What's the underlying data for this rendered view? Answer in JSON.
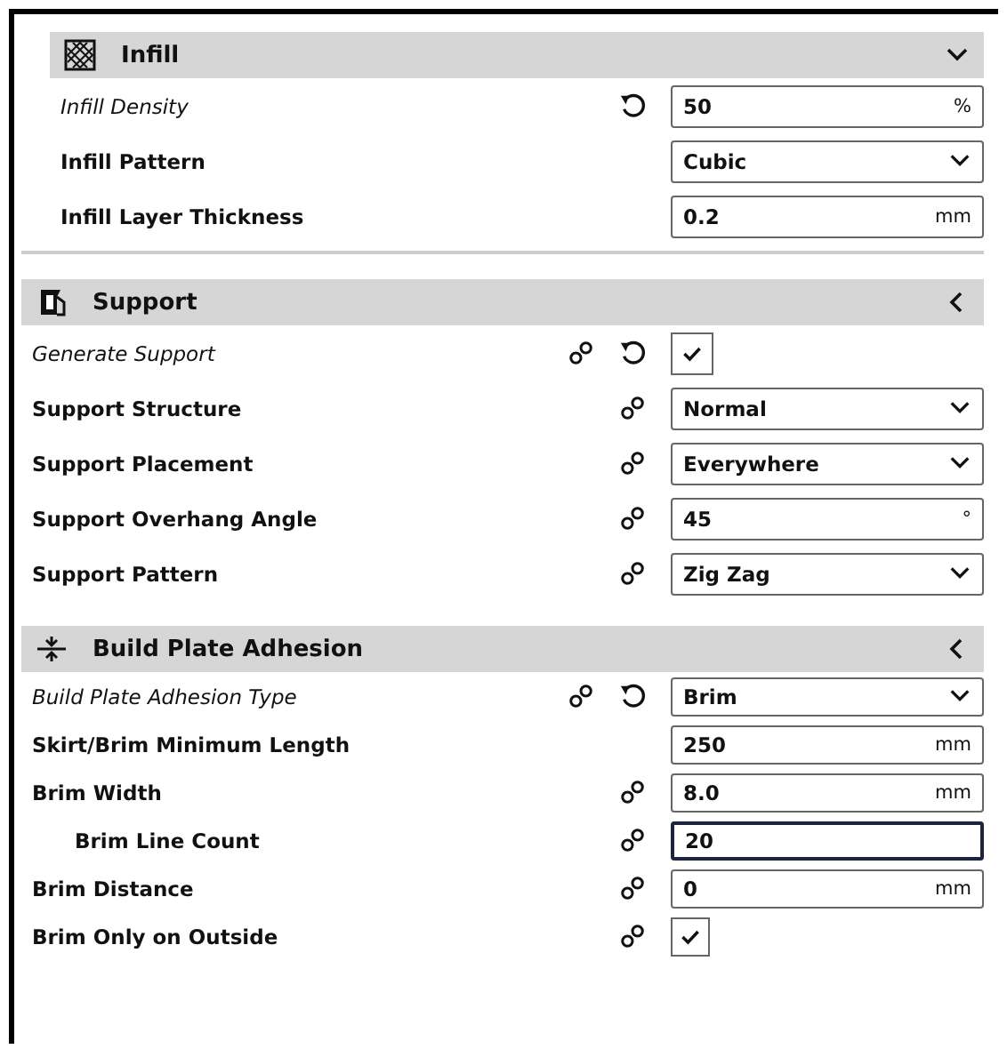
{
  "sections": [
    {
      "title": "Infill",
      "expanded": true,
      "rows": [
        {
          "label": "Infill Density",
          "modified": true,
          "linked": false,
          "reset": true,
          "kind": "number",
          "value": "50",
          "unit": "%"
        },
        {
          "label": "Infill Pattern",
          "modified": false,
          "linked": false,
          "reset": false,
          "kind": "select",
          "value": "Cubic"
        },
        {
          "label": "Infill Layer Thickness",
          "modified": false,
          "linked": false,
          "reset": false,
          "kind": "number",
          "value": "0.2",
          "unit": "mm"
        }
      ]
    },
    {
      "title": "Support",
      "expanded": false,
      "rows": [
        {
          "label": "Generate Support",
          "modified": true,
          "linked": true,
          "reset": true,
          "kind": "checkbox",
          "checked": true
        },
        {
          "label": "Support Structure",
          "modified": false,
          "linked": true,
          "reset": false,
          "kind": "select",
          "value": "Normal"
        },
        {
          "label": "Support Placement",
          "modified": false,
          "linked": true,
          "reset": false,
          "kind": "select",
          "value": "Everywhere"
        },
        {
          "label": "Support Overhang Angle",
          "modified": false,
          "linked": true,
          "reset": false,
          "kind": "number",
          "value": "45",
          "unit": "°"
        },
        {
          "label": "Support Pattern",
          "modified": false,
          "linked": true,
          "reset": false,
          "kind": "select",
          "value": "Zig Zag"
        }
      ]
    },
    {
      "title": "Build Plate Adhesion",
      "expanded": false,
      "rows": [
        {
          "label": "Build Plate Adhesion Type",
          "modified": true,
          "linked": true,
          "reset": true,
          "kind": "select",
          "value": "Brim"
        },
        {
          "label": "Skirt/Brim Minimum Length",
          "modified": false,
          "linked": false,
          "reset": false,
          "kind": "number",
          "value": "250",
          "unit": "mm"
        },
        {
          "label": "Brim Width",
          "modified": false,
          "linked": true,
          "reset": false,
          "kind": "number",
          "value": "8.0",
          "unit": "mm",
          "children": [
            {
              "label": "Brim Line Count",
              "modified": false,
              "linked": true,
              "reset": false,
              "kind": "number",
              "value": "20",
              "focused": true
            }
          ]
        },
        {
          "label": "Brim Distance",
          "modified": false,
          "linked": true,
          "reset": false,
          "kind": "number",
          "value": "0",
          "unit": "mm"
        },
        {
          "label": "Brim Only on Outside",
          "modified": false,
          "linked": true,
          "reset": false,
          "kind": "checkbox",
          "checked": true
        }
      ]
    }
  ]
}
